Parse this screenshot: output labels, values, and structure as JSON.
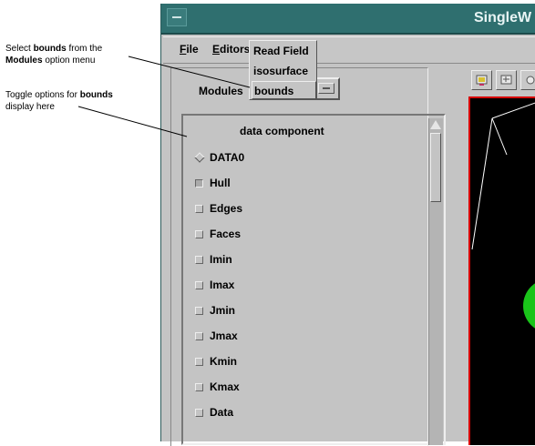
{
  "annotations": {
    "select": {
      "pre": "Select ",
      "bold1": "bounds",
      "mid": " from the",
      "bold2": "Modules",
      "post": " option menu"
    },
    "toggle": {
      "pre": "Toggle options for ",
      "bold": "bounds",
      "post": "display here"
    }
  },
  "window": {
    "title": "SingleW"
  },
  "menubar": {
    "file": {
      "first": "F",
      "rest": "ile"
    },
    "editors": {
      "first": "E",
      "rest": "ditors"
    }
  },
  "modules": {
    "label": "Modules",
    "selected": "bounds",
    "options": [
      "Read Field",
      "isosurface",
      "bounds"
    ]
  },
  "panel": {
    "header": "data component",
    "items": [
      {
        "label": "DATA0",
        "kind": "radio",
        "checked": true
      },
      {
        "label": "Hull",
        "kind": "check",
        "checked": true
      },
      {
        "label": "Edges",
        "kind": "check",
        "checked": false
      },
      {
        "label": "Faces",
        "kind": "check",
        "checked": false
      },
      {
        "label": "Imin",
        "kind": "check",
        "checked": false
      },
      {
        "label": "Imax",
        "kind": "check",
        "checked": false
      },
      {
        "label": "Jmin",
        "kind": "check",
        "checked": false
      },
      {
        "label": "Jmax",
        "kind": "check",
        "checked": false
      },
      {
        "label": "Kmin",
        "kind": "check",
        "checked": false
      },
      {
        "label": "Kmax",
        "kind": "check",
        "checked": false
      },
      {
        "label": "Data",
        "kind": "check",
        "checked": false
      }
    ]
  },
  "toolbar": {
    "icons": [
      "view-icon-1",
      "view-icon-2",
      "view-icon-3"
    ]
  },
  "colors": {
    "titlebar": "#2f6f6f",
    "viewer_border": "#d60000",
    "sphere": "#1ac41a"
  }
}
